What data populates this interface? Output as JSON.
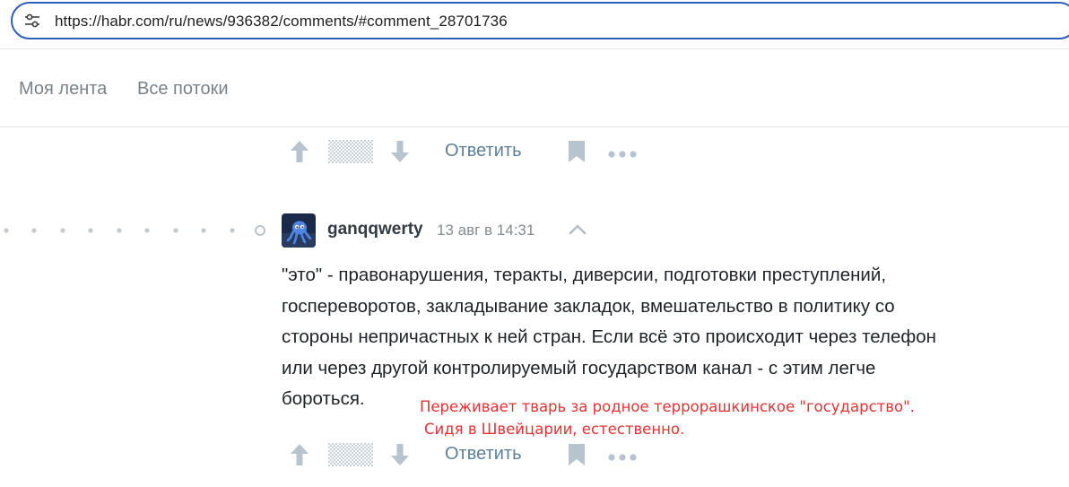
{
  "browser": {
    "url": "https://habr.com/ru/news/936382/comments/#comment_28701736"
  },
  "nav": {
    "items": [
      {
        "label": "Моя лента"
      },
      {
        "label": "Все потоки"
      }
    ]
  },
  "comment_actions": {
    "reply_label": "Ответить"
  },
  "comment": {
    "author": "ganqqwerty",
    "time": "13 авг в 14:31",
    "body_lines": [
      "\"это\" - правонарушения, теракты, диверсии, подготовки преступлений,",
      "госпереворотов, закладывание закладок, вмешательство в политику со",
      "стороны непричастных к ней стран. Если всё это происходит через телефон",
      "или через другой контролируемый государством канал - с этим легче",
      "бороться."
    ]
  },
  "annotation": {
    "color": "#e53232",
    "lines": [
      "Переживает тварь за родное террорашкинское \"государство\".",
      "Сидя в Швейцарии, естественно."
    ]
  },
  "colors": {
    "address_bar_border": "#2d5fb8",
    "reply_link": "#5d7f98",
    "icon_gray": "#b7c4ce",
    "nav_text": "#7b8287"
  }
}
